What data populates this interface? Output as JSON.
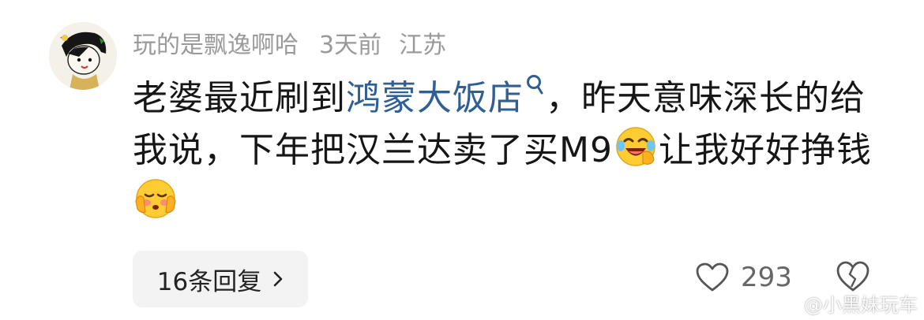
{
  "comment": {
    "username": "玩的是飘逸啊哈",
    "time": "3天前",
    "location": "江苏",
    "text_part1": "老婆最近刷到",
    "topic": "鸿蒙大饭店",
    "text_part2": "，昨天意味深长的给我说，下年把汉兰达卖了买M9",
    "text_part3": "让我好好挣钱",
    "replies_label": "16条回复",
    "like_count": "293",
    "watermark": "@小黑妹玩车"
  },
  "icons": {
    "avatar": "cartoon-avatar",
    "topic_search": "search-icon",
    "emoji1": "laughing-crying-emoji",
    "emoji2": "shy-blushing-emoji",
    "replies_arrow": "chevron-right-icon",
    "like": "heart-icon",
    "dislike": "broken-heart-icon"
  }
}
